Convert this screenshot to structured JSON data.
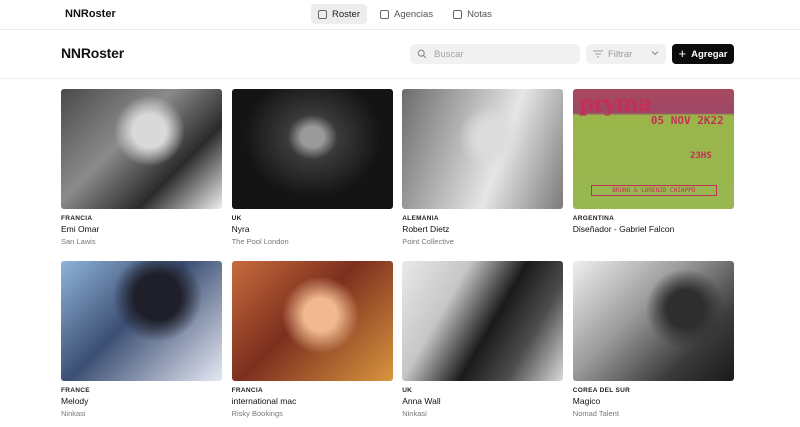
{
  "app": {
    "brand": "NNRoster"
  },
  "nav": {
    "tabs": [
      {
        "label": "Roster",
        "active": true
      },
      {
        "label": "Agencias",
        "active": false
      },
      {
        "label": "Notas",
        "active": false
      }
    ]
  },
  "header": {
    "title": "NNRoster",
    "search_placeholder": "Buscar",
    "filter_label": "Filtrar",
    "add_label": "Agregar"
  },
  "artists": [
    {
      "country": "FRANCIA",
      "name": "Emi Omar",
      "agency": "San Lawis"
    },
    {
      "country": "UK",
      "name": "Nyra",
      "agency": "The Pool London"
    },
    {
      "country": "ALEMANIA",
      "name": "Robert Dietz",
      "agency": "Point Collective"
    },
    {
      "country": "ARGENTINA",
      "name": "Diseñador - Gabriel Falcon",
      "agency": ""
    },
    {
      "country": "FRANCE",
      "name": "Melody",
      "agency": "Ninkasi"
    },
    {
      "country": "FRANCIA",
      "name": "international mac",
      "agency": "Risky Bookings"
    },
    {
      "country": "UK",
      "name": "Anna Wall",
      "agency": "Ninkasi"
    },
    {
      "country": "COREA DEL SUR",
      "name": "Magico",
      "agency": "Nomad Talent"
    }
  ],
  "poster": {
    "title": "pryma",
    "date": "05 NOV 2K22",
    "time": "23HS",
    "lineup": "BRUNO & LORENZO CHIAPPO"
  },
  "icons": {
    "search": "search-icon",
    "filter": "filter-icon",
    "chevron": "chevron-down-icon",
    "plus": "plus-icon"
  }
}
